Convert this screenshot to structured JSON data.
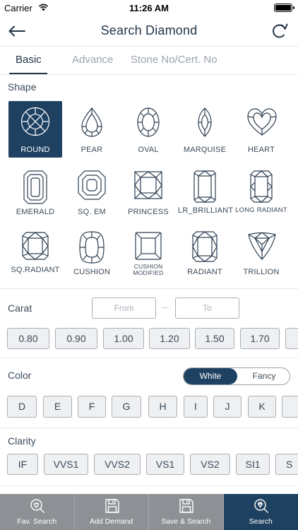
{
  "status_bar": {
    "carrier": "Carrier",
    "time": "11:26 AM"
  },
  "nav": {
    "title": "Search Diamond"
  },
  "tabs": [
    {
      "label": "Basic"
    },
    {
      "label": "Advance"
    },
    {
      "label": "Stone No/Cert. No"
    }
  ],
  "shape": {
    "label": "Shape",
    "items": [
      {
        "label": "ROUND"
      },
      {
        "label": "PEAR"
      },
      {
        "label": "OVAL"
      },
      {
        "label": "MARQUISE"
      },
      {
        "label": "HEART"
      },
      {
        "label": "EMERALD"
      },
      {
        "label": "SQ. EM"
      },
      {
        "label": "PRINCESS"
      },
      {
        "label": "LR_BRILLIANT"
      },
      {
        "label": "LONG RADIANT"
      },
      {
        "label": "SQ.RADIANT"
      },
      {
        "label": "CUSHION"
      },
      {
        "label": "CUSHION MODIFIED"
      },
      {
        "label": "RADIANT"
      },
      {
        "label": "TRILLION"
      }
    ]
  },
  "carat": {
    "label": "Carat",
    "from_placeholder": "From",
    "to_placeholder": "To",
    "chips": [
      "0.80",
      "0.90",
      "1.00",
      "1.20",
      "1.50",
      "1.70"
    ]
  },
  "color": {
    "label": "Color",
    "toggle": {
      "white": "White",
      "fancy": "Fancy"
    },
    "chips": [
      "D",
      "E",
      "F",
      "G",
      "H",
      "I",
      "J",
      "K"
    ]
  },
  "clarity": {
    "label": "Clarity",
    "chips": [
      "IF",
      "VVS1",
      "VVS2",
      "VS1",
      "VS2",
      "SI1",
      "S"
    ]
  },
  "bottom_bar": [
    {
      "label": "Fav. Search"
    },
    {
      "label": "Add Demand"
    },
    {
      "label": "Save & Search"
    },
    {
      "label": "Search"
    }
  ],
  "colors": {
    "primary": "#1f4161",
    "text": "#3c4a58",
    "bottom_bar": "#8d9196"
  }
}
